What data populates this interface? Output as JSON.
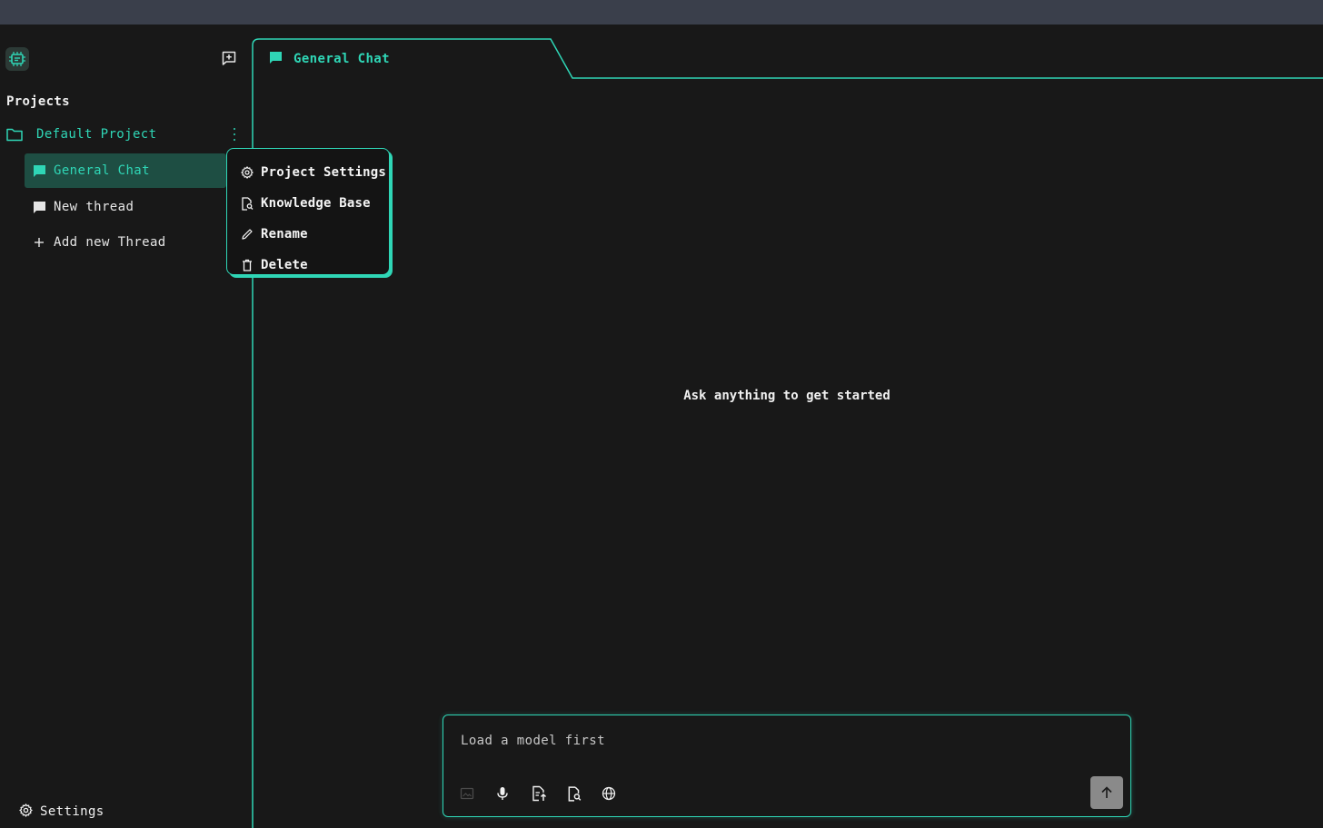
{
  "sidebar": {
    "projects_label": "Projects",
    "project": {
      "name": "Default Project"
    },
    "threads": [
      {
        "label": "General Chat",
        "active": true
      },
      {
        "label": "New thread",
        "active": false
      }
    ],
    "add_thread_label": "Add new Thread",
    "settings_label": "Settings"
  },
  "main": {
    "active_tab": "General Chat",
    "empty_message": "Ask anything to get started"
  },
  "context_menu": {
    "items": [
      {
        "label": "Project Settings",
        "icon": "gear-icon"
      },
      {
        "label": "Knowledge Base",
        "icon": "document-search-icon"
      },
      {
        "label": "Rename",
        "icon": "pencil-icon"
      },
      {
        "label": "Delete",
        "icon": "trash-icon"
      }
    ]
  },
  "composer": {
    "placeholder": "Load a model first",
    "tools": [
      "image-icon",
      "microphone-icon",
      "document-upload-icon",
      "document-search-icon",
      "globe-icon"
    ]
  },
  "colors": {
    "accent": "#2fd6b6",
    "background": "#181818",
    "topbar": "#3a3f4b",
    "active_thread_bg": "#1e4e43",
    "send_button": "#8a8a8a"
  }
}
